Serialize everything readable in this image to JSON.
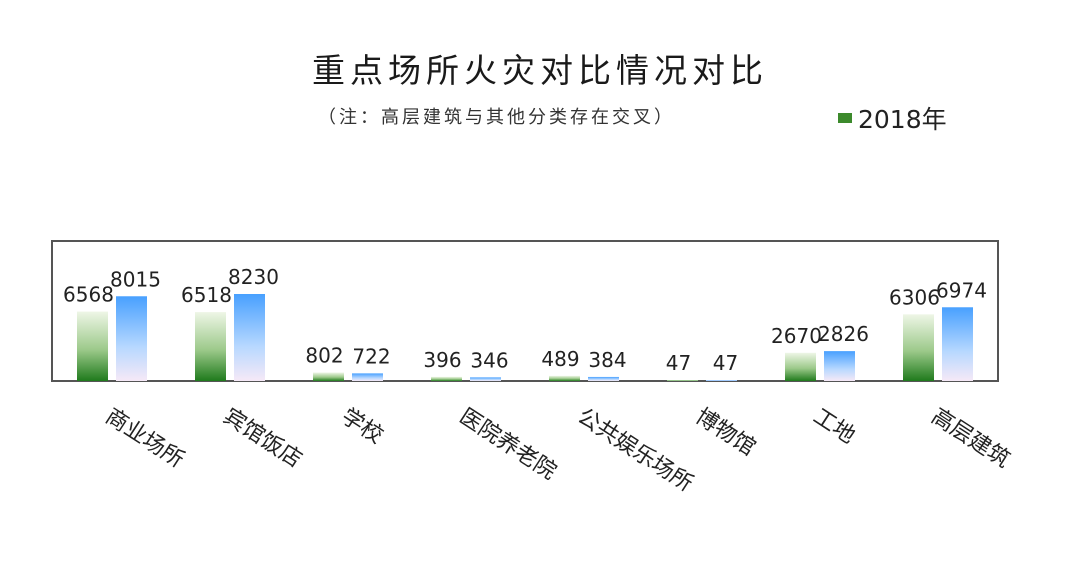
{
  "chart_data": {
    "type": "bar",
    "title": "重点场所火灾对比情况对比",
    "subtitle": "（注：高层建筑与其他分类存在交叉）",
    "categories": [
      "商业场所",
      "宾馆饭店",
      "学校",
      "医院养老院",
      "公共娱乐场所",
      "博物馆",
      "工地",
      "高层建筑"
    ],
    "series": [
      {
        "name": "2018年",
        "values": [
          6568,
          6518,
          802,
          396,
          489,
          47,
          2670,
          6306
        ]
      },
      {
        "name": "",
        "values": [
          8015,
          8230,
          722,
          346,
          384,
          47,
          2826,
          6974
        ]
      }
    ],
    "legend": {
      "position": "top-right"
    },
    "colors": {
      "series1_top": "#e9f3de",
      "series1_bottom": "#1f7a1c",
      "series2_top": "#4aa3ff",
      "series2_bottom": "#f1e6f7",
      "frame": "#555555"
    },
    "grid": false
  }
}
